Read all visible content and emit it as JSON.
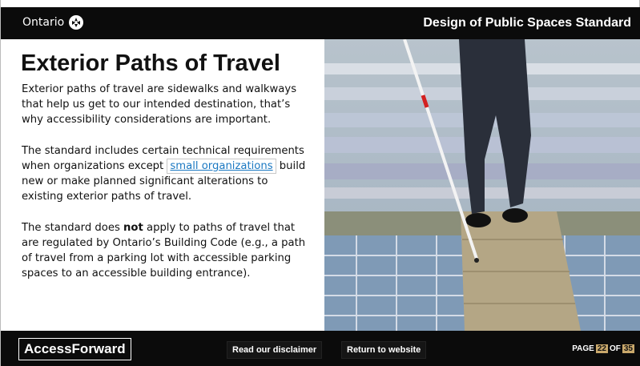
{
  "header": {
    "brand": "Ontario",
    "title": "Design of Public Spaces Standard"
  },
  "main": {
    "heading": "Exterior Paths of Travel",
    "p1": "Exterior paths of travel are sidewalks and walkways that help us get to our intended destination, that’s why accessibility considerations are important.",
    "p2_before": "The standard includes certain technical requirements when organizations except ",
    "p2_link": "small organizations",
    "p2_after": " build new or make planned significant alterations to existing exterior paths of travel.",
    "p3_before": "The standard does ",
    "p3_bold": "not",
    "p3_after": " apply to paths of travel that are regulated by Ontario’s Building Code (e.g., a path of travel from a parking lot with accessible parking spaces to an accessible building entrance)."
  },
  "footer": {
    "logo": "AccessForward",
    "disclaimer_button": "Read our disclaimer",
    "return_button": "Return to website",
    "page_label": "PAGE",
    "page_current": "22",
    "page_of": "OF",
    "page_total": "35"
  }
}
